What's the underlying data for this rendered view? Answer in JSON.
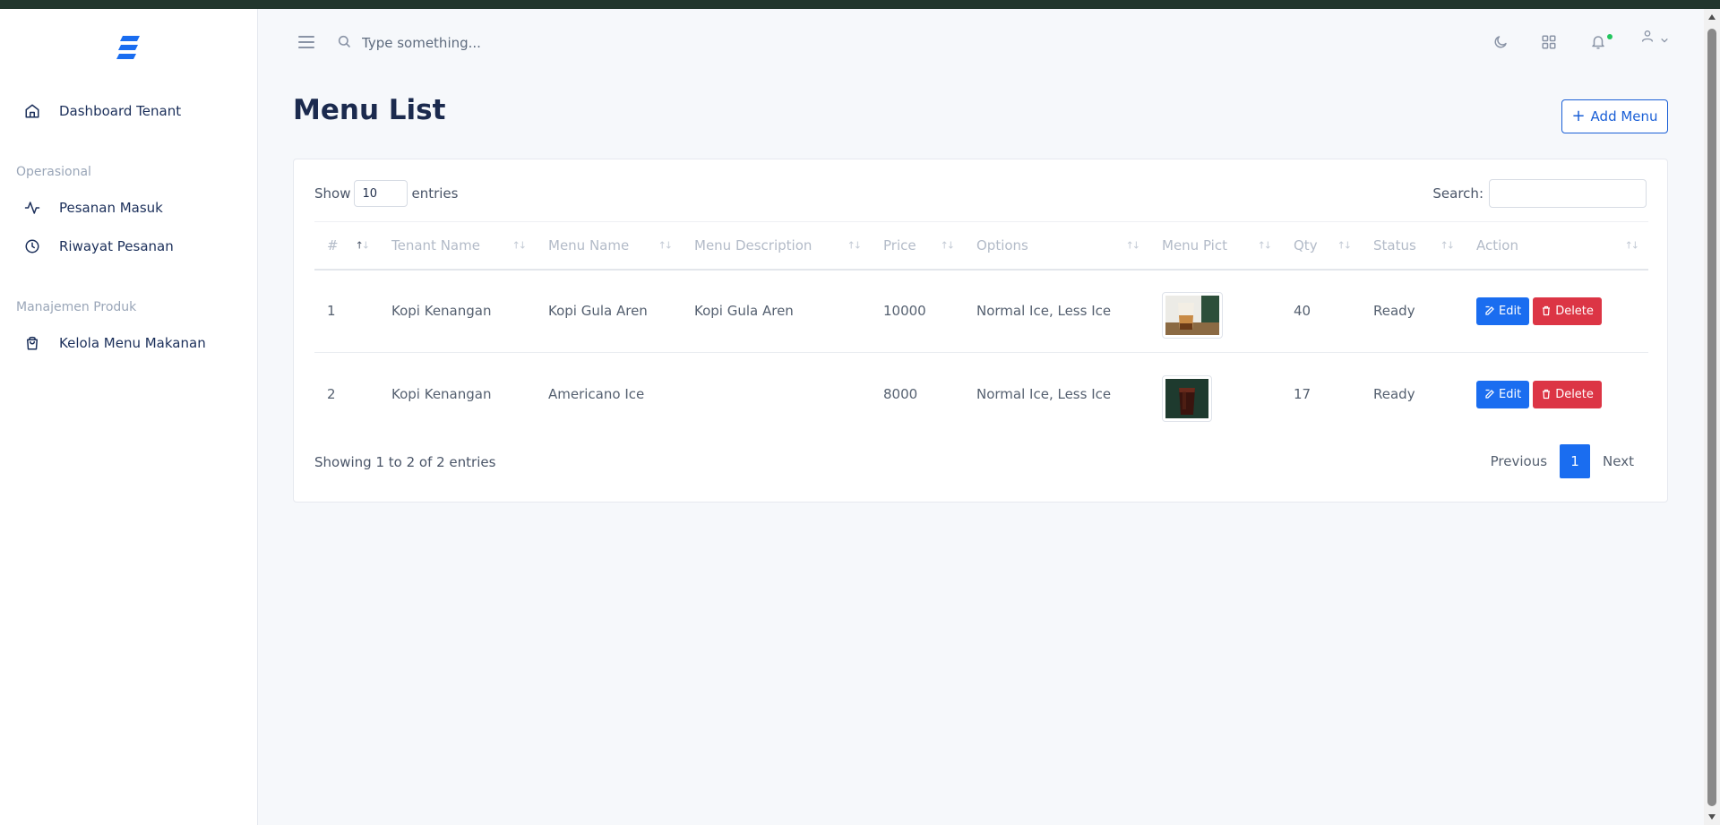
{
  "sidebar": {
    "items": [
      {
        "label": "Dashboard Tenant",
        "icon": "home-icon"
      },
      {
        "label": "Pesanan Masuk",
        "icon": "activity-icon"
      },
      {
        "label": "Riwayat Pesanan",
        "icon": "clock-icon"
      },
      {
        "label": "Kelola Menu Makanan",
        "icon": "shopping-bag-icon"
      }
    ],
    "sections": [
      "Operasional",
      "Manajemen Produk"
    ]
  },
  "topbar": {
    "search_placeholder": "Type something..."
  },
  "page": {
    "title": "Menu List",
    "add_button_label": "Add Menu"
  },
  "table_controls": {
    "show_label": "Show",
    "entries_value": "10",
    "entries_label": "entries",
    "search_label": "Search:"
  },
  "table": {
    "columns": [
      "#",
      "Tenant Name",
      "Menu Name",
      "Menu Description",
      "Price",
      "Options",
      "Menu Pict",
      "Qty",
      "Status",
      "Action"
    ],
    "rows": [
      {
        "no": "1",
        "tenant": "Kopi Kenangan",
        "menu": "Kopi Gula Aren",
        "description": "Kopi Gula Aren",
        "price": "10000",
        "options": "Normal Ice, Less Ice",
        "qty": "40",
        "status": "Ready"
      },
      {
        "no": "2",
        "tenant": "Kopi Kenangan",
        "menu": "Americano Ice",
        "description": "",
        "price": "8000",
        "options": "Normal Ice, Less Ice",
        "qty": "17",
        "status": "Ready"
      }
    ],
    "edit_label": "Edit",
    "delete_label": "Delete"
  },
  "footer": {
    "info": "Showing 1 to 2 of 2 entries",
    "previous": "Previous",
    "current_page": "1",
    "next": "Next"
  },
  "colors": {
    "primary": "#1a6df0",
    "danger": "#dc3545",
    "title": "#1b2a4e",
    "status_dot": "#22c55e"
  }
}
